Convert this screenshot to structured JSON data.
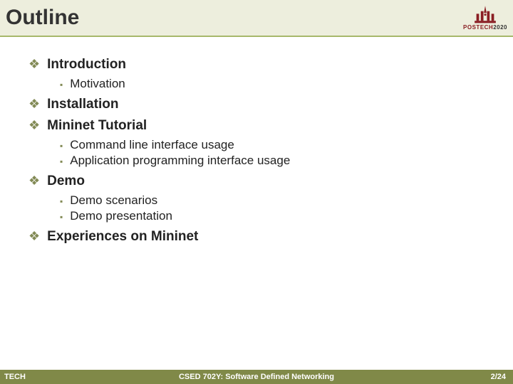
{
  "header": {
    "title": "Outline",
    "logo": {
      "wordmark": "POSTECH",
      "year": "2020"
    }
  },
  "outline": [
    {
      "label": "Introduction",
      "sub": [
        "Motivation"
      ]
    },
    {
      "label": "Installation",
      "sub": []
    },
    {
      "label": "Mininet Tutorial",
      "sub": [
        "Command line interface usage",
        "Application programming interface usage"
      ]
    },
    {
      "label": "Demo",
      "sub": [
        "Demo scenarios",
        "Demo presentation"
      ]
    },
    {
      "label": "Experiences on Mininet",
      "sub": []
    }
  ],
  "footer": {
    "left": "TECH",
    "center": "CSED 702Y: Software Defined Networking",
    "right": "2/24"
  }
}
